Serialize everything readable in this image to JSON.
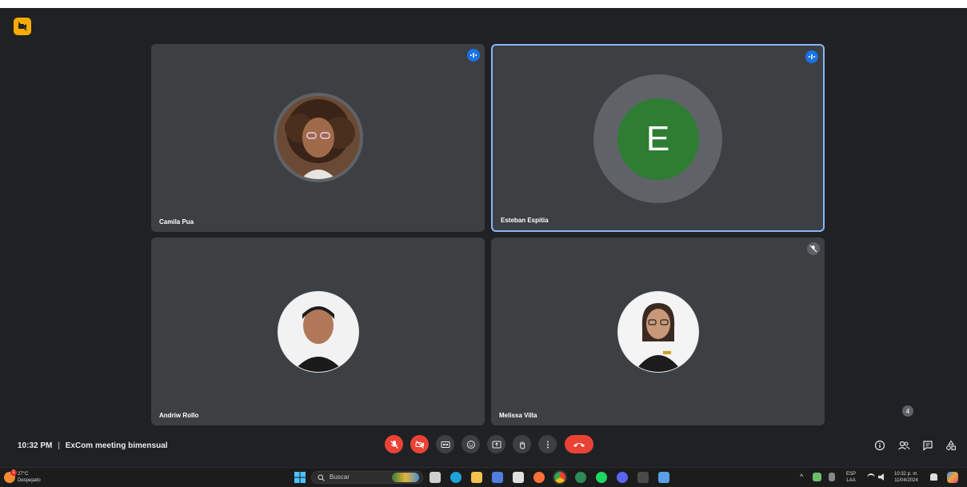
{
  "meeting": {
    "time": "10:32 PM",
    "separator": "|",
    "title": "ExCom meeting bimensual",
    "participant_count": "4"
  },
  "participants": [
    {
      "name": "Camila Pua",
      "state": "speaking"
    },
    {
      "name": "Esteban Espitia",
      "state": "speaking",
      "avatar_letter": "E",
      "avatar_color": "#2e7d32"
    },
    {
      "name": "Andriw Rollo",
      "state": "normal"
    },
    {
      "name": "Melissa Villa",
      "state": "muted"
    }
  ],
  "controls": [
    {
      "name": "mic-off-icon"
    },
    {
      "name": "camera-off-icon"
    },
    {
      "name": "captions-icon"
    },
    {
      "name": "emoji-icon"
    },
    {
      "name": "present-icon"
    },
    {
      "name": "raise-hand-icon"
    },
    {
      "name": "more-options-icon"
    },
    {
      "name": "hangup-icon"
    }
  ],
  "colors": {
    "accent": "#8ab4f8",
    "danger": "#ea4335",
    "speaking": "#1a73e8",
    "tile": "#3c4043",
    "background": "#202124"
  },
  "taskbar": {
    "weather_temp": "27°C",
    "weather_desc": "Despejado",
    "weather_badge": "1",
    "search_placeholder": "Buscar",
    "lang_top": "ESP",
    "lang_bottom": "LAA",
    "clock_time": "10:32 p. m.",
    "clock_date": "11/04/2024"
  }
}
